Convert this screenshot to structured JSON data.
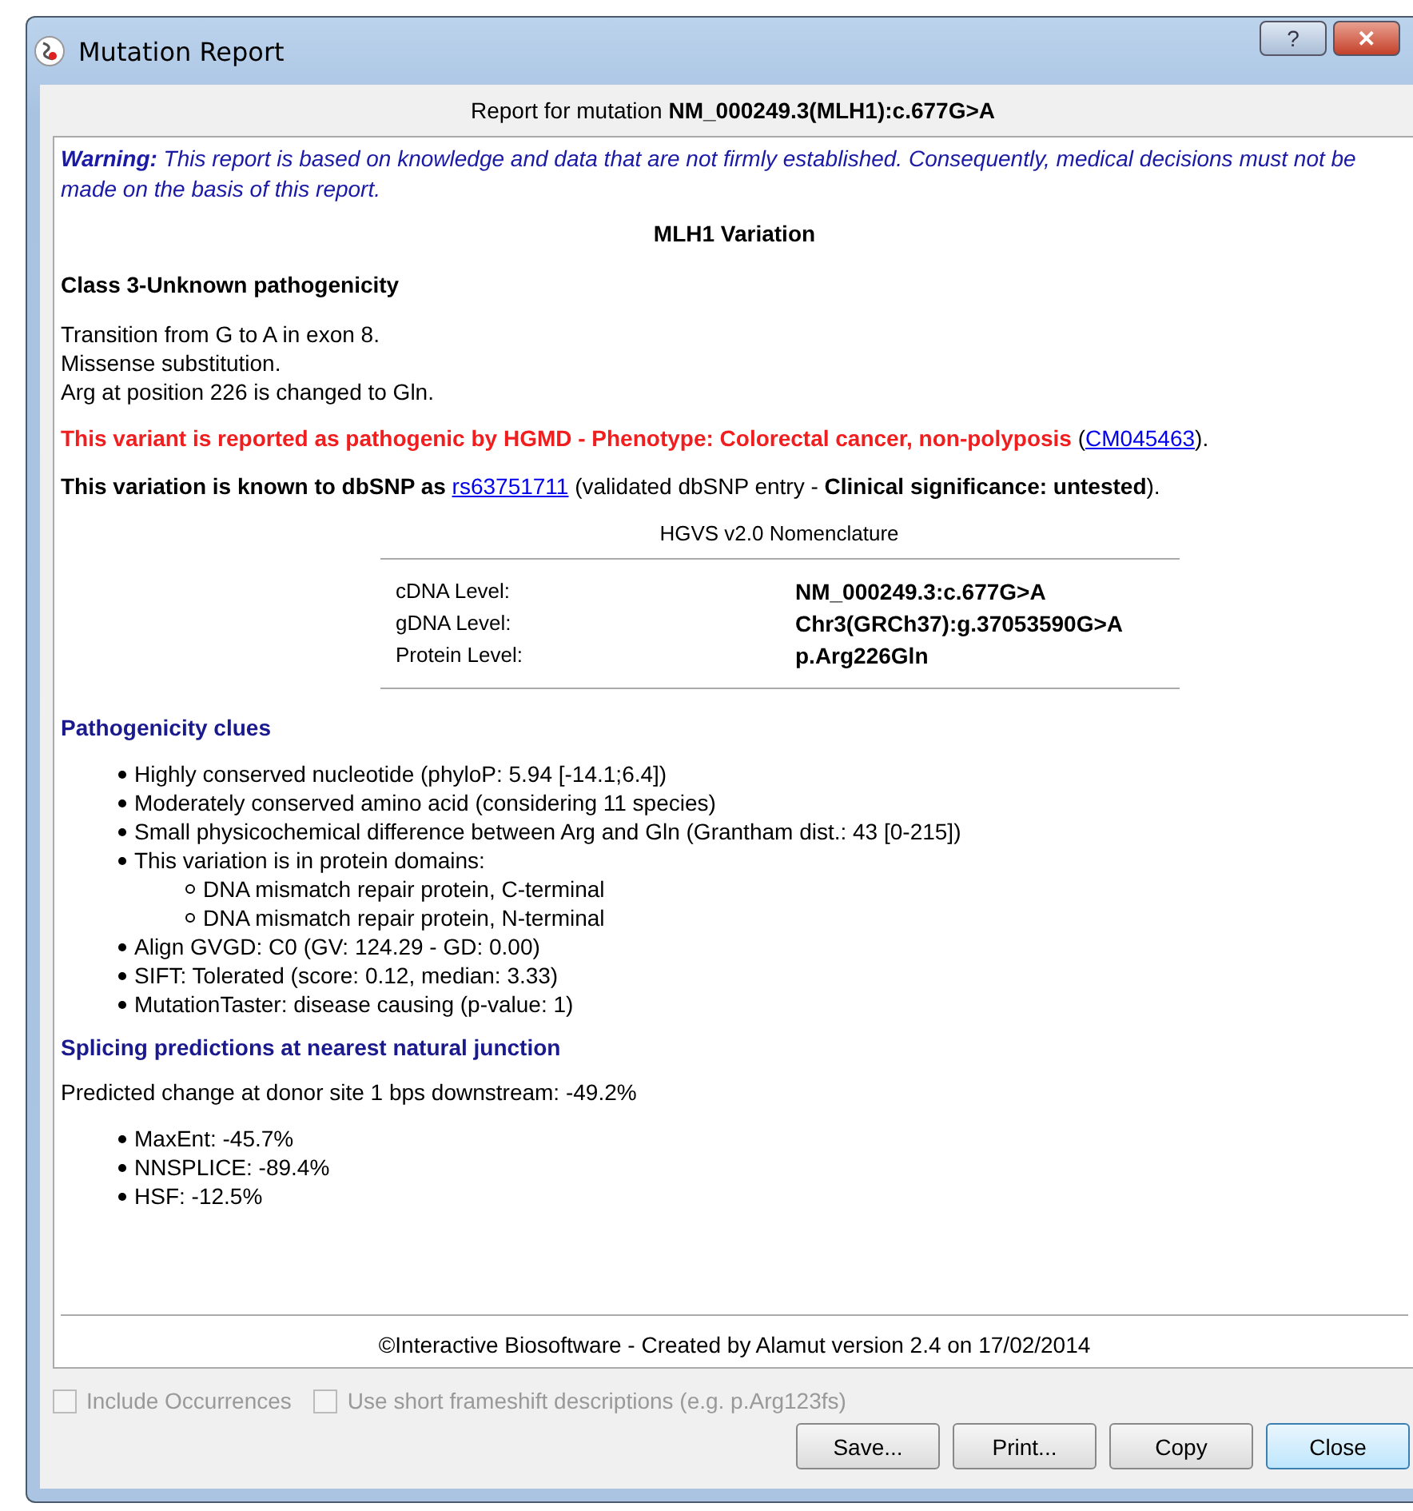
{
  "window": {
    "title": "Mutation Report",
    "buttons": [
      {
        "kind": "help",
        "label": "?"
      },
      {
        "kind": "close",
        "label": "✕"
      }
    ]
  },
  "header": "Report for mutation **NM_000249.3(MLH1):c.677G>A**",
  "warning": "**Warning:** This report is based on knowledge and data that are not firmly established. Consequently, medical decisions must not be made on the basis of this report.",
  "gene_title": "MLH1 Variation",
  "class_title": "Class 3-Unknown pathogenicity",
  "description": [
    "Transition from G to A in exon 8.",
    "Missense substitution.",
    "Arg at position 226 is changed to Gln."
  ],
  "hgmd": {
    "text": "This variant is reported as pathogenic by HGMD - Phenotype: Colorectal cancer, non-polyposis",
    "open": "(",
    "link": "CM045463",
    "close": ")."
  },
  "dbsnp": {
    "before": "**This variation is known to dbSNP as**",
    "link": "rs63751711",
    "after": "(validated dbSNP entry - **Clinical significance: untested**)."
  },
  "nomenclature": {
    "title": "HGVS v2.0 Nomenclature",
    "rows": [
      {
        "label": "cDNA Level:",
        "value": "NM_000249.3:c.677G>A"
      },
      {
        "label": "gDNA Level:",
        "value": "Chr3(GRCh37):g.37053590G>A"
      },
      {
        "label": "Protein Level:",
        "value": "p.Arg226Gln"
      }
    ]
  },
  "clues": {
    "title": "Pathogenicity clues",
    "items": [
      {
        "text": "Highly conserved nucleotide (phyloP: 5.94 [-14.1;6.4])"
      },
      {
        "text": "Moderately conserved amino acid (considering 11 species)"
      },
      {
        "text": "Small physicochemical difference between Arg and Gln (Grantham dist.: 43 [0-215])"
      },
      {
        "text": "This variation is in protein domains:",
        "children": [
          {
            "text": "DNA mismatch repair protein, C-terminal"
          },
          {
            "text": "DNA mismatch repair protein, N-terminal"
          }
        ]
      },
      {
        "text": "Align GVGD: C0 (GV: 124.29 - GD: 0.00)"
      },
      {
        "text": "SIFT: Tolerated (score: 0.12, median: 3.33)"
      },
      {
        "text": "MutationTaster: disease causing (p-value: 1)"
      }
    ]
  },
  "splicing": {
    "title": "Splicing predictions at nearest natural junction",
    "summary": "Predicted change at donor site 1 bps downstream: -49.2%",
    "items": [
      {
        "text": "MaxEnt: -45.7%"
      },
      {
        "text": "NNSPLICE: -89.4%"
      },
      {
        "text": "HSF: -12.5%"
      }
    ]
  },
  "footer": "©Interactive Biosoftware - Created by Alamut version 2.4 on 17/02/2014",
  "options": [
    {
      "label": "Include Occurrences",
      "checked": false,
      "disabled": true
    },
    {
      "label": "Use short frameshift descriptions (e.g. p.Arg123fs)",
      "checked": false,
      "disabled": true
    }
  ],
  "buttons": [
    {
      "label": "Save...",
      "default": false
    },
    {
      "label": "Print...",
      "default": false
    },
    {
      "label": "Copy",
      "default": false
    },
    {
      "label": "Close",
      "default": true
    }
  ]
}
